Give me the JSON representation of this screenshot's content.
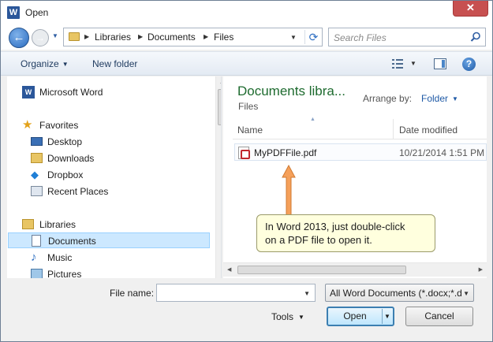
{
  "window": {
    "title": "Open",
    "close_glyph": "✕",
    "app_logo": "W"
  },
  "nav": {
    "back_glyph": "←",
    "forward_glyph": "→",
    "breadcrumbs": [
      "Libraries",
      "Documents",
      "Files"
    ],
    "refresh_glyph": "⟳",
    "search_placeholder": "Search Files"
  },
  "toolbar": {
    "organize": "Organize",
    "new_folder": "New folder",
    "help_glyph": "?"
  },
  "sidebar": {
    "items": [
      {
        "label": "Microsoft Word",
        "icon": "word-icon"
      },
      {
        "label": "Favorites",
        "icon": "star-icon"
      },
      {
        "label": "Desktop",
        "icon": "desktop-icon"
      },
      {
        "label": "Downloads",
        "icon": "downloads-icon"
      },
      {
        "label": "Dropbox",
        "icon": "dropbox-icon"
      },
      {
        "label": "Recent Places",
        "icon": "recent-places-icon"
      },
      {
        "label": "Libraries",
        "icon": "libraries-icon"
      },
      {
        "label": "Documents",
        "icon": "documents-icon",
        "selected": true
      },
      {
        "label": "Music",
        "icon": "music-icon"
      },
      {
        "label": "Pictures",
        "icon": "pictures-icon"
      }
    ]
  },
  "content": {
    "library_title": "Documents libra...",
    "library_subtitle": "Files",
    "arrange_label": "Arrange by:",
    "arrange_value": "Folder",
    "columns": [
      "Name",
      "Date modified"
    ],
    "files": [
      {
        "name": "MyPDFFile.pdf",
        "date_modified": "10/21/2014 1:51 PM",
        "icon": "pdf-icon"
      }
    ]
  },
  "callout": {
    "line1": "In Word 2013, just double-click",
    "line2": "on a PDF file to open it."
  },
  "footer": {
    "file_name_label": "File name:",
    "file_name_value": "",
    "file_type": "All Word Documents (*.docx;*.d",
    "tools_label": "Tools",
    "open_label": "Open",
    "cancel_label": "Cancel"
  },
  "colors": {
    "library_title": "#1e6b2f",
    "selected_bg": "#cce8ff",
    "callout_bg": "#ffffde",
    "callout_arrow": "#f5a05a",
    "close_button": "#c75050"
  }
}
